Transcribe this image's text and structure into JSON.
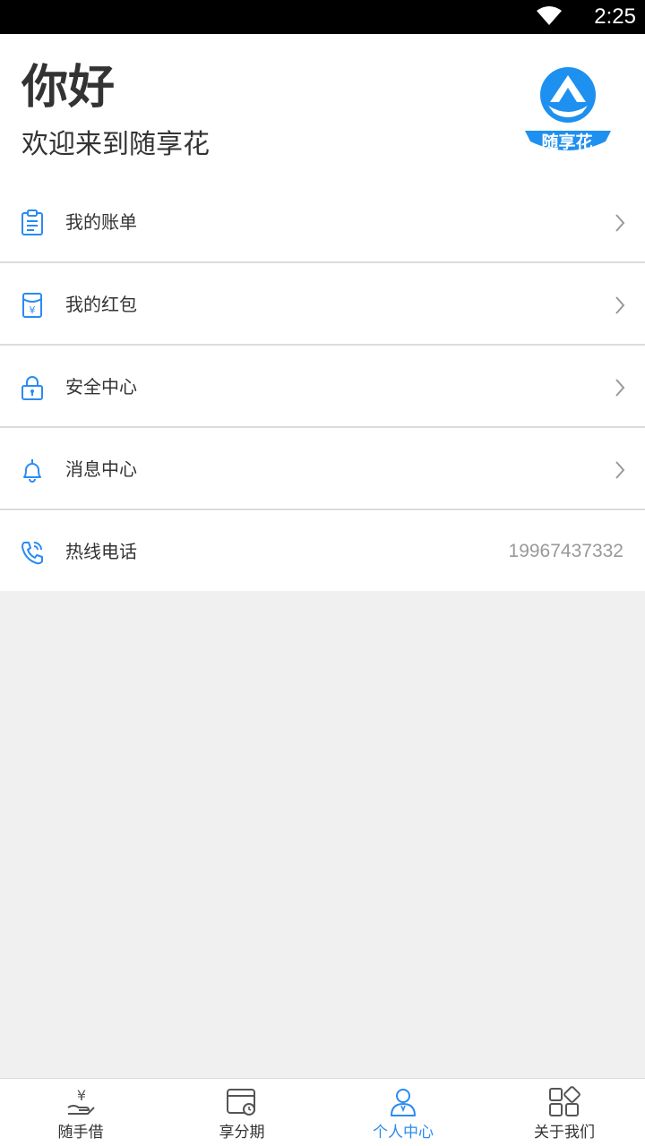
{
  "status_bar": {
    "time": "2:25"
  },
  "header": {
    "greeting": "你好",
    "welcome": "欢迎来到随享花",
    "logo_text": "随享花"
  },
  "menu": [
    {
      "label": "我的账单",
      "icon": "bill-icon"
    },
    {
      "label": "我的红包",
      "icon": "red-envelope-icon"
    },
    {
      "label": "安全中心",
      "icon": "lock-icon"
    },
    {
      "label": "消息中心",
      "icon": "bell-icon"
    },
    {
      "label": "热线电话",
      "icon": "phone-icon",
      "value": "19967437332"
    }
  ],
  "tabbar": {
    "tabs": [
      {
        "label": "随手借",
        "icon": "loan-hand-icon"
      },
      {
        "label": "享分期",
        "icon": "installment-icon"
      },
      {
        "label": "个人中心",
        "icon": "user-icon",
        "active": true
      },
      {
        "label": "关于我们",
        "icon": "grid-icon"
      }
    ]
  },
  "colors": {
    "accent": "#2a8bf2",
    "logo_blue": "#1e90ef",
    "divider": "#dcdcdc",
    "background": "#f0f0f0"
  }
}
